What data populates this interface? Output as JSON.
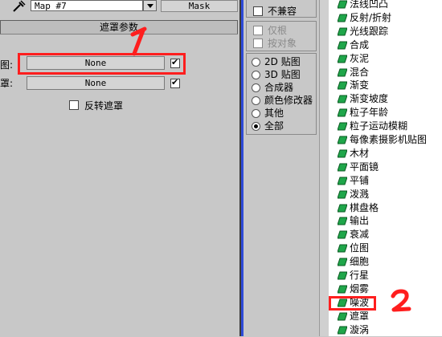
{
  "top_bar": {
    "map_name": "Map #7",
    "mask_label": "Mask"
  },
  "rollout": {
    "title": "遮罩参数"
  },
  "map_row": {
    "label": "图:",
    "value": "None",
    "checked": true
  },
  "mask_row": {
    "label": "罩:",
    "value": "None",
    "checked": true
  },
  "invert": {
    "label": "反转遮罩",
    "checked": false
  },
  "annotations": {
    "mark1": "1",
    "mark2": "2",
    "accent": "#ff1e1e"
  },
  "browser_options": {
    "checks": [
      {
        "label": "不兼容",
        "checked": false
      }
    ],
    "show_checks": [
      {
        "label": "仅根",
        "checked": true,
        "disabled": true
      },
      {
        "label": "按对象",
        "checked": false,
        "disabled": true
      }
    ],
    "radios": [
      {
        "label": "2D 贴图",
        "selected": false
      },
      {
        "label": "3D 贴图",
        "selected": false
      },
      {
        "label": "合成器",
        "selected": false
      },
      {
        "label": "颜色修改器",
        "selected": false
      },
      {
        "label": "其他",
        "selected": false
      },
      {
        "label": "全部",
        "selected": true
      }
    ]
  },
  "map_list": {
    "icon_color": "#1fa64a",
    "items": [
      "法线凹凸",
      "反射/折射",
      "光线跟踪",
      "合成",
      "灰泥",
      "混合",
      "渐变",
      "渐变坡度",
      "粒子年龄",
      "粒子运动模糊",
      "每像素摄影机贴图",
      "木材",
      "平面镜",
      "平铺",
      "泼溅",
      "棋盘格",
      "输出",
      "衰减",
      "位图",
      "细胞",
      "行星",
      "烟雾",
      "噪波",
      "遮罩",
      "漩涡"
    ]
  }
}
